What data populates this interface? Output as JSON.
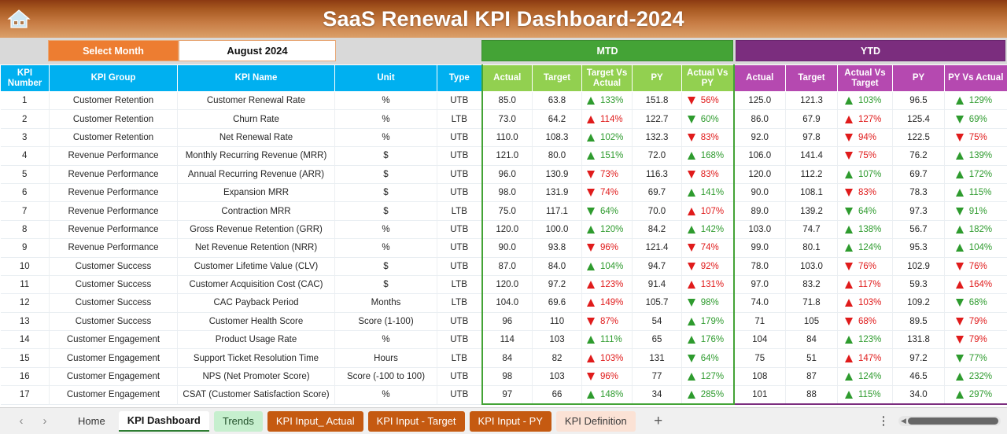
{
  "window": {
    "title": "SaaS Renewal KPI Dashboard-2024",
    "home_icon": "home-icon",
    "title_bar_color": "#a6571f"
  },
  "selector": {
    "label": "Select Month",
    "value": "August 2024",
    "label_color": "#ED7D31"
  },
  "sections": {
    "mtd": {
      "label": "MTD",
      "color": "#44A336"
    },
    "ytd": {
      "label": "YTD",
      "color": "#7B2D7E"
    }
  },
  "columns": {
    "info": [
      "KPI Number",
      "KPI Group",
      "KPI Name",
      "Unit",
      "Type"
    ],
    "mtd": [
      "Actual",
      "Target",
      "Target Vs Actual",
      "PY",
      "Actual Vs PY"
    ],
    "ytd": [
      "Actual",
      "Target",
      "Actual Vs Target",
      "PY",
      "PY Vs Actual"
    ]
  },
  "colors": {
    "up": "#2E9B2E",
    "down": "#E01B1B",
    "header_blue": "#00B0F0",
    "header_green": "#92D050",
    "header_purple": "#B549B0"
  },
  "rows": [
    {
      "num": "1",
      "group": "Customer Retention",
      "name": "Customer Renewal Rate",
      "unit": "%",
      "type": "UTB",
      "mtd": {
        "actual": "85.0",
        "target": "63.8",
        "tva": "133%",
        "tva_dir": "up",
        "tva_color": "up",
        "py": "151.8",
        "avp": "56%",
        "avp_dir": "down",
        "avp_color": "down"
      },
      "ytd": {
        "actual": "125.0",
        "target": "121.3",
        "avt": "103%",
        "avt_dir": "up",
        "avt_color": "up",
        "py": "96.5",
        "pva": "129%",
        "pva_dir": "up",
        "pva_color": "up"
      }
    },
    {
      "num": "2",
      "group": "Customer Retention",
      "name": "Churn Rate",
      "unit": "%",
      "type": "LTB",
      "mtd": {
        "actual": "73.0",
        "target": "64.2",
        "tva": "114%",
        "tva_dir": "up",
        "tva_color": "down",
        "py": "122.7",
        "avp": "60%",
        "avp_dir": "down",
        "avp_color": "up"
      },
      "ytd": {
        "actual": "86.0",
        "target": "67.9",
        "avt": "127%",
        "avt_dir": "up",
        "avt_color": "down",
        "py": "125.4",
        "pva": "69%",
        "pva_dir": "down",
        "pva_color": "up"
      }
    },
    {
      "num": "3",
      "group": "Customer Retention",
      "name": "Net Renewal Rate",
      "unit": "%",
      "type": "UTB",
      "mtd": {
        "actual": "110.0",
        "target": "108.3",
        "tva": "102%",
        "tva_dir": "up",
        "tva_color": "up",
        "py": "132.3",
        "avp": "83%",
        "avp_dir": "down",
        "avp_color": "down"
      },
      "ytd": {
        "actual": "92.0",
        "target": "97.8",
        "avt": "94%",
        "avt_dir": "down",
        "avt_color": "down",
        "py": "122.5",
        "pva": "75%",
        "pva_dir": "down",
        "pva_color": "down"
      }
    },
    {
      "num": "4",
      "group": "Revenue Performance",
      "name": "Monthly Recurring Revenue (MRR)",
      "unit": "$",
      "type": "UTB",
      "mtd": {
        "actual": "121.0",
        "target": "80.0",
        "tva": "151%",
        "tva_dir": "up",
        "tva_color": "up",
        "py": "72.0",
        "avp": "168%",
        "avp_dir": "up",
        "avp_color": "up"
      },
      "ytd": {
        "actual": "106.0",
        "target": "141.4",
        "avt": "75%",
        "avt_dir": "down",
        "avt_color": "down",
        "py": "76.2",
        "pva": "139%",
        "pva_dir": "up",
        "pva_color": "up"
      }
    },
    {
      "num": "5",
      "group": "Revenue Performance",
      "name": "Annual Recurring Revenue (ARR)",
      "unit": "$",
      "type": "UTB",
      "mtd": {
        "actual": "96.0",
        "target": "130.9",
        "tva": "73%",
        "tva_dir": "down",
        "tva_color": "down",
        "py": "116.3",
        "avp": "83%",
        "avp_dir": "down",
        "avp_color": "down"
      },
      "ytd": {
        "actual": "120.0",
        "target": "112.2",
        "avt": "107%",
        "avt_dir": "up",
        "avt_color": "up",
        "py": "69.7",
        "pva": "172%",
        "pva_dir": "up",
        "pva_color": "up"
      }
    },
    {
      "num": "6",
      "group": "Revenue Performance",
      "name": "Expansion MRR",
      "unit": "$",
      "type": "UTB",
      "mtd": {
        "actual": "98.0",
        "target": "131.9",
        "tva": "74%",
        "tva_dir": "down",
        "tva_color": "down",
        "py": "69.7",
        "avp": "141%",
        "avp_dir": "up",
        "avp_color": "up"
      },
      "ytd": {
        "actual": "90.0",
        "target": "108.1",
        "avt": "83%",
        "avt_dir": "down",
        "avt_color": "down",
        "py": "78.3",
        "pva": "115%",
        "pva_dir": "up",
        "pva_color": "up"
      }
    },
    {
      "num": "7",
      "group": "Revenue Performance",
      "name": "Contraction MRR",
      "unit": "$",
      "type": "LTB",
      "mtd": {
        "actual": "75.0",
        "target": "117.1",
        "tva": "64%",
        "tva_dir": "down",
        "tva_color": "up",
        "py": "70.0",
        "avp": "107%",
        "avp_dir": "up",
        "avp_color": "down"
      },
      "ytd": {
        "actual": "89.0",
        "target": "139.2",
        "avt": "64%",
        "avt_dir": "down",
        "avt_color": "up",
        "py": "97.3",
        "pva": "91%",
        "pva_dir": "down",
        "pva_color": "up"
      }
    },
    {
      "num": "8",
      "group": "Revenue Performance",
      "name": "Gross Revenue Retention (GRR)",
      "unit": "%",
      "type": "UTB",
      "mtd": {
        "actual": "120.0",
        "target": "100.0",
        "tva": "120%",
        "tva_dir": "up",
        "tva_color": "up",
        "py": "84.2",
        "avp": "142%",
        "avp_dir": "up",
        "avp_color": "up"
      },
      "ytd": {
        "actual": "103.0",
        "target": "74.7",
        "avt": "138%",
        "avt_dir": "up",
        "avt_color": "up",
        "py": "56.7",
        "pva": "182%",
        "pva_dir": "up",
        "pva_color": "up"
      }
    },
    {
      "num": "9",
      "group": "Revenue Performance",
      "name": "Net Revenue Retention (NRR)",
      "unit": "%",
      "type": "UTB",
      "mtd": {
        "actual": "90.0",
        "target": "93.8",
        "tva": "96%",
        "tva_dir": "down",
        "tva_color": "down",
        "py": "121.4",
        "avp": "74%",
        "avp_dir": "down",
        "avp_color": "down"
      },
      "ytd": {
        "actual": "99.0",
        "target": "80.1",
        "avt": "124%",
        "avt_dir": "up",
        "avt_color": "up",
        "py": "95.3",
        "pva": "104%",
        "pva_dir": "up",
        "pva_color": "up"
      }
    },
    {
      "num": "10",
      "group": "Customer Success",
      "name": "Customer Lifetime Value (CLV)",
      "unit": "$",
      "type": "UTB",
      "mtd": {
        "actual": "87.0",
        "target": "84.0",
        "tva": "104%",
        "tva_dir": "up",
        "tva_color": "up",
        "py": "94.7",
        "avp": "92%",
        "avp_dir": "down",
        "avp_color": "down"
      },
      "ytd": {
        "actual": "78.0",
        "target": "103.0",
        "avt": "76%",
        "avt_dir": "down",
        "avt_color": "down",
        "py": "102.9",
        "pva": "76%",
        "pva_dir": "down",
        "pva_color": "down"
      }
    },
    {
      "num": "11",
      "group": "Customer Success",
      "name": "Customer Acquisition Cost (CAC)",
      "unit": "$",
      "type": "LTB",
      "mtd": {
        "actual": "120.0",
        "target": "97.2",
        "tva": "123%",
        "tva_dir": "up",
        "tva_color": "down",
        "py": "91.4",
        "avp": "131%",
        "avp_dir": "up",
        "avp_color": "down"
      },
      "ytd": {
        "actual": "97.0",
        "target": "83.2",
        "avt": "117%",
        "avt_dir": "up",
        "avt_color": "down",
        "py": "59.3",
        "pva": "164%",
        "pva_dir": "up",
        "pva_color": "down"
      }
    },
    {
      "num": "12",
      "group": "Customer Success",
      "name": "CAC Payback Period",
      "unit": "Months",
      "type": "LTB",
      "mtd": {
        "actual": "104.0",
        "target": "69.6",
        "tva": "149%",
        "tva_dir": "up",
        "tva_color": "down",
        "py": "105.7",
        "avp": "98%",
        "avp_dir": "down",
        "avp_color": "up"
      },
      "ytd": {
        "actual": "74.0",
        "target": "71.8",
        "avt": "103%",
        "avt_dir": "up",
        "avt_color": "down",
        "py": "109.2",
        "pva": "68%",
        "pva_dir": "down",
        "pva_color": "up"
      }
    },
    {
      "num": "13",
      "group": "Customer Success",
      "name": "Customer Health Score",
      "unit": "Score (1-100)",
      "type": "UTB",
      "mtd": {
        "actual": "96",
        "target": "110",
        "tva": "87%",
        "tva_dir": "down",
        "tva_color": "down",
        "py": "54",
        "avp": "179%",
        "avp_dir": "up",
        "avp_color": "up"
      },
      "ytd": {
        "actual": "71",
        "target": "105",
        "avt": "68%",
        "avt_dir": "down",
        "avt_color": "down",
        "py": "89.5",
        "pva": "79%",
        "pva_dir": "down",
        "pva_color": "down"
      }
    },
    {
      "num": "14",
      "group": "Customer Engagement",
      "name": "Product Usage Rate",
      "unit": "%",
      "type": "UTB",
      "mtd": {
        "actual": "114",
        "target": "103",
        "tva": "111%",
        "tva_dir": "up",
        "tva_color": "up",
        "py": "65",
        "avp": "176%",
        "avp_dir": "up",
        "avp_color": "up"
      },
      "ytd": {
        "actual": "104",
        "target": "84",
        "avt": "123%",
        "avt_dir": "up",
        "avt_color": "up",
        "py": "131.8",
        "pva": "79%",
        "pva_dir": "down",
        "pva_color": "down"
      }
    },
    {
      "num": "15",
      "group": "Customer Engagement",
      "name": "Support Ticket Resolution Time",
      "unit": "Hours",
      "type": "LTB",
      "mtd": {
        "actual": "84",
        "target": "82",
        "tva": "103%",
        "tva_dir": "up",
        "tva_color": "down",
        "py": "131",
        "avp": "64%",
        "avp_dir": "down",
        "avp_color": "up"
      },
      "ytd": {
        "actual": "75",
        "target": "51",
        "avt": "147%",
        "avt_dir": "up",
        "avt_color": "down",
        "py": "97.2",
        "pva": "77%",
        "pva_dir": "down",
        "pva_color": "up"
      }
    },
    {
      "num": "16",
      "group": "Customer Engagement",
      "name": "NPS (Net Promoter Score)",
      "unit": "Score (-100 to 100)",
      "type": "UTB",
      "mtd": {
        "actual": "98",
        "target": "103",
        "tva": "96%",
        "tva_dir": "down",
        "tva_color": "down",
        "py": "77",
        "avp": "127%",
        "avp_dir": "up",
        "avp_color": "up"
      },
      "ytd": {
        "actual": "108",
        "target": "87",
        "avt": "124%",
        "avt_dir": "up",
        "avt_color": "up",
        "py": "46.5",
        "pva": "232%",
        "pva_dir": "up",
        "pva_color": "up"
      }
    },
    {
      "num": "17",
      "group": "Customer Engagement",
      "name": "CSAT (Customer Satisfaction Score)",
      "unit": "%",
      "type": "UTB",
      "mtd": {
        "actual": "97",
        "target": "66",
        "tva": "148%",
        "tva_dir": "up",
        "tva_color": "up",
        "py": "34",
        "avp": "285%",
        "avp_dir": "up",
        "avp_color": "up"
      },
      "ytd": {
        "actual": "101",
        "target": "88",
        "avt": "115%",
        "avt_dir": "up",
        "avt_color": "up",
        "py": "34.0",
        "pva": "297%",
        "pva_dir": "up",
        "pva_color": "up"
      }
    }
  ],
  "tabbar": {
    "prev": "‹",
    "next": "›",
    "add": "+",
    "tabs": [
      {
        "label": "Home",
        "style": "plain"
      },
      {
        "label": "KPI Dashboard",
        "style": "active"
      },
      {
        "label": "Trends",
        "style": "t-green"
      },
      {
        "label": "KPI Input_ Actual",
        "style": "t-orange"
      },
      {
        "label": "KPI Input - Target",
        "style": "t-orange"
      },
      {
        "label": "KPI Input - PY",
        "style": "t-orange"
      },
      {
        "label": "KPI Definition",
        "style": "t-peach"
      }
    ]
  }
}
